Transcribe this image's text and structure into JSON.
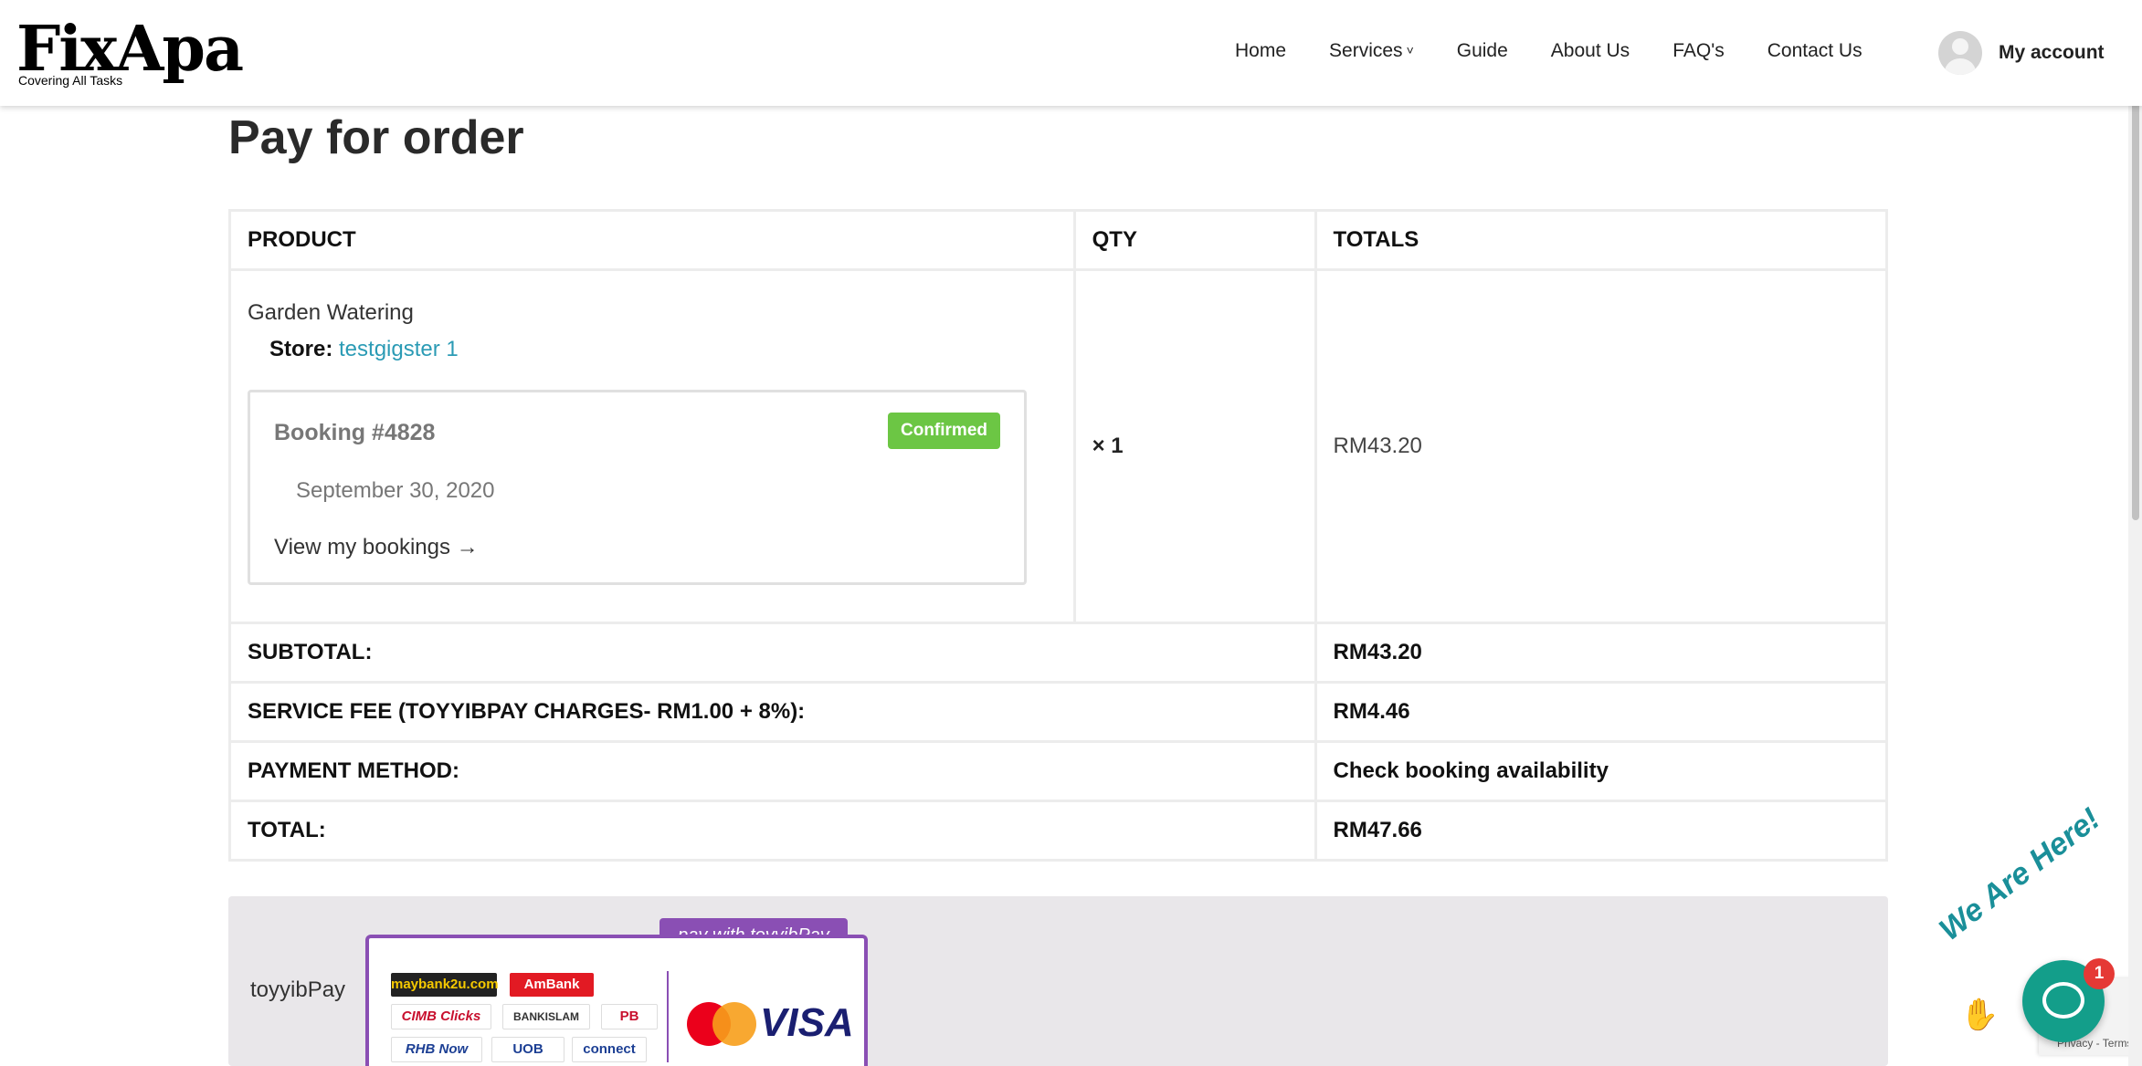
{
  "header": {
    "logo_text": "FixApa",
    "logo_tagline": "Covering All Tasks",
    "nav": [
      {
        "label": "Home"
      },
      {
        "label": "Services",
        "has_dropdown": true
      },
      {
        "label": "Guide"
      },
      {
        "label": "About Us"
      },
      {
        "label": "FAQ's"
      },
      {
        "label": "Contact Us"
      }
    ],
    "account_label": "My account"
  },
  "page_title": "Pay for order",
  "order_table": {
    "headers": [
      "PRODUCT",
      "QTY",
      "TOTALS"
    ],
    "item": {
      "name": "Garden Watering",
      "store_label": "Store:",
      "store_name": "testgigster 1",
      "booking_title": "Booking #4828",
      "booking_status": "Confirmed",
      "booking_date": "September 30, 2020",
      "booking_link": "View my bookings →",
      "qty": "× 1",
      "price": "RM43.20"
    },
    "summary": [
      {
        "label": "SUBTOTAL:",
        "value": "RM43.20"
      },
      {
        "label": "SERVICE FEE (TOYYIBPAY CHARGES- RM1.00 + 8%):",
        "value": "RM4.46"
      },
      {
        "label": "PAYMENT METHOD:",
        "value": "Check booking availability"
      },
      {
        "label": "TOTAL:",
        "value": "RM47.66"
      }
    ]
  },
  "payment": {
    "method_label": "toyyibPay",
    "banner_tag": "pay with toyyibPay",
    "banks": [
      "maybank2u.com",
      "AmBank",
      "CIMB Clicks",
      "BANKISLAM",
      "PB",
      "RHB Now",
      "UOB",
      "connect"
    ],
    "cards": [
      "mastercard",
      "VISA"
    ]
  },
  "chat_widget": {
    "label": "We Are Here!",
    "badge_count": "1"
  },
  "recaptcha": {
    "text": "Privacy - Terms"
  },
  "colors": {
    "accent_link": "#2b9bb5",
    "status_confirmed": "#6cc644",
    "toyyibpay_purple": "#8a4fb4",
    "chat_teal": "#139e8a"
  }
}
